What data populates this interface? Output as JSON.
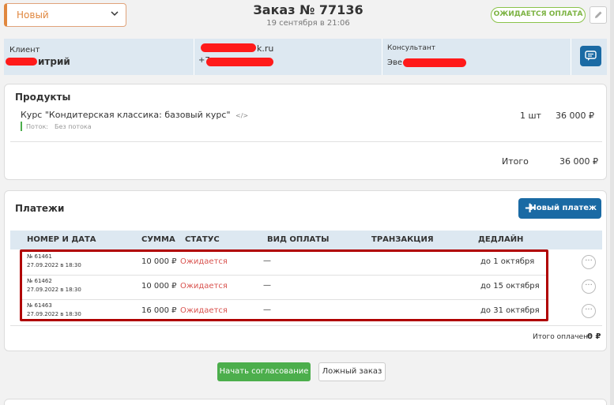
{
  "header": {
    "status_value": "Новый",
    "order_title": "Заказ № 77136",
    "order_date": "19 сентября в 21:06",
    "status_badge": "ОЖИДАЕТСЯ ОПЛАТА"
  },
  "client_strip": {
    "client_label": "Клиент",
    "client_name": "итрий",
    "email_visible": "k.ru",
    "phone_visible": "+7",
    "consultant_label": "Консультант",
    "consultant_name": "Эве"
  },
  "products": {
    "title": "Продукты",
    "item_name": "Курс \"Кондитерская классика: базовый курс\"",
    "item_code_icon": "</>",
    "stream_label": "Поток:",
    "stream_value": "Без потока",
    "qty": "1 шт",
    "price": "36 000 ₽",
    "total_label": "Итого",
    "total_value": "36 000 ₽"
  },
  "payments": {
    "title": "Платежи",
    "new_payment_label": "Новый платеж",
    "columns": [
      "НОМЕР И ДАТА",
      "СУММА",
      "СТАТУС",
      "ВИД ОПЛАТЫ",
      "ТРАНЗАКЦИЯ",
      "ДЕДЛАЙН"
    ],
    "rows": [
      {
        "number": "№ 61461",
        "date": "27.09.2022 в 18:30",
        "sum": "10 000 ₽",
        "status": "Ожидается",
        "type": "—",
        "deadline": "до 1 октября"
      },
      {
        "number": "№ 61462",
        "date": "27.09.2022 в 18:30",
        "sum": "10 000 ₽",
        "status": "Ожидается",
        "type": "—",
        "deadline": "до 15 октября"
      },
      {
        "number": "№ 61463",
        "date": "27.09.2022 в 18:30",
        "sum": "16 000 ₽",
        "status": "Ожидается",
        "type": "—",
        "deadline": "до 31 октября"
      }
    ],
    "total_paid_label": "Итого оплачено",
    "total_paid_value": "0 ₽"
  },
  "actions": {
    "start_approval": "Начать согласование",
    "false_order": "Ложный заказ"
  },
  "icons": {
    "chevron": "chevron-down-icon",
    "edit": "pencil-icon",
    "chat": "chat-icon",
    "plus": "plus-icon",
    "more": "more-icon"
  },
  "colors": {
    "accent_blue": "#1a6aa4",
    "status_orange": "#e0873e",
    "badge_green": "#7cb342",
    "waiting_red": "#d9534f",
    "highlight_red": "#b00000",
    "button_green": "#4cae4c"
  }
}
